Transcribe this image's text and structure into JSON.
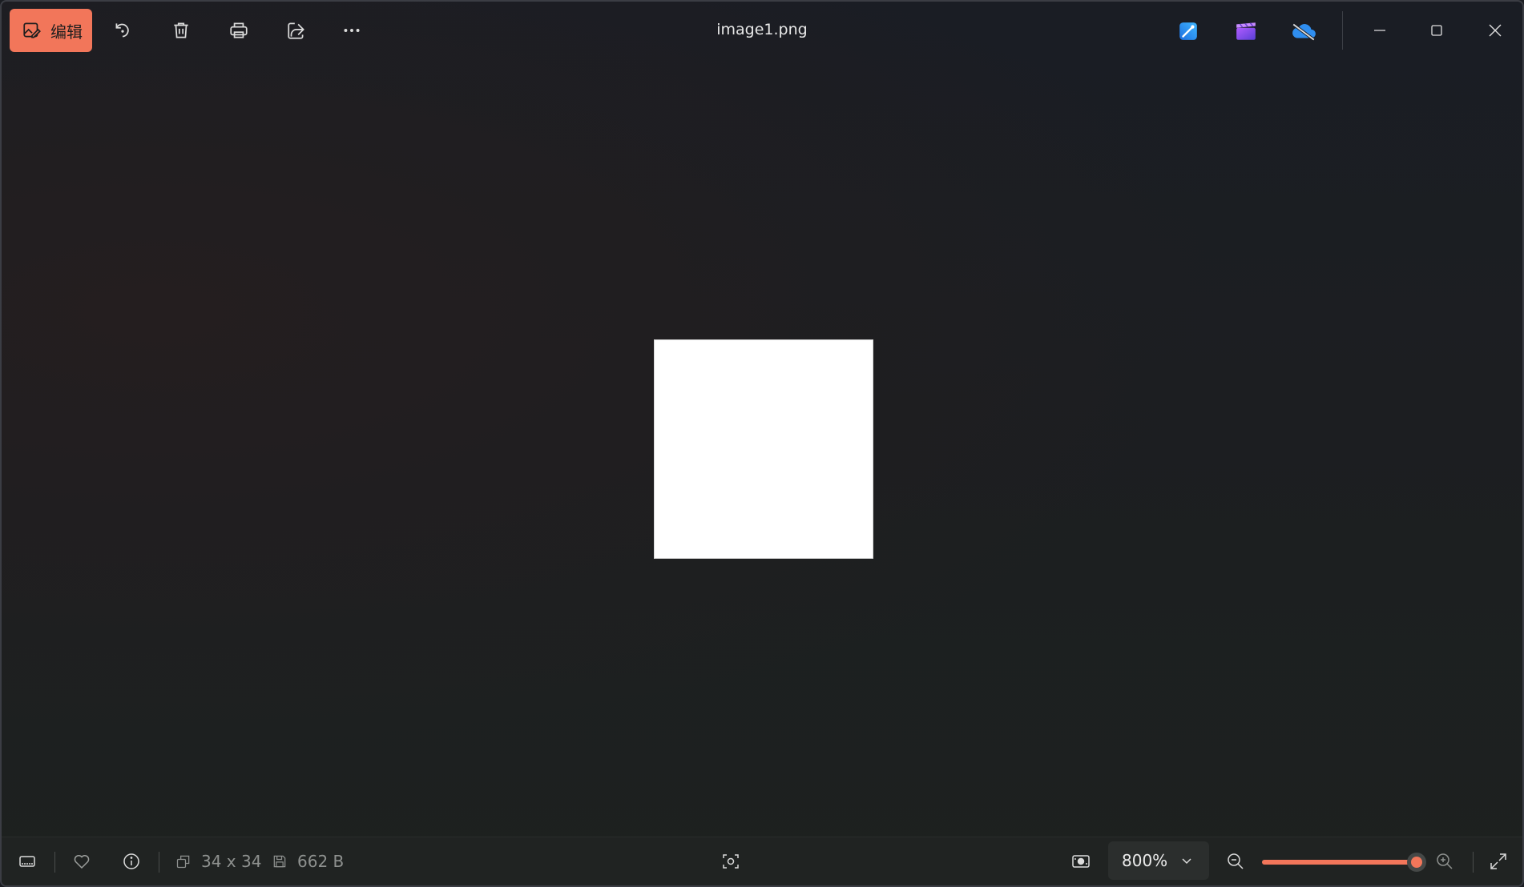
{
  "toolbar": {
    "edit_label": "编辑",
    "accent_color": "#f2765a",
    "buttons": [
      {
        "name": "rotate-button",
        "icon": "rotate-icon"
      },
      {
        "name": "delete-button",
        "icon": "trash-icon"
      },
      {
        "name": "print-button",
        "icon": "printer-icon"
      },
      {
        "name": "share-button",
        "icon": "share-icon"
      },
      {
        "name": "more-button",
        "icon": "more-icon"
      }
    ]
  },
  "window": {
    "title": "image1.png"
  },
  "apps": [
    {
      "name": "designer-app",
      "icon": "designer-icon",
      "color": "#1e8fff"
    },
    {
      "name": "clipchamp-app",
      "icon": "clipchamp-icon",
      "color": "#7a4cff"
    },
    {
      "name": "onedrive-app",
      "icon": "onedrive-off-icon",
      "color": "#2f8ef0"
    }
  ],
  "image": {
    "fill": "#ffffff"
  },
  "footer": {
    "dimensions": "34 x 34",
    "file_size": "662 B",
    "zoom_value": "800%",
    "zoom_level": 1.0
  }
}
